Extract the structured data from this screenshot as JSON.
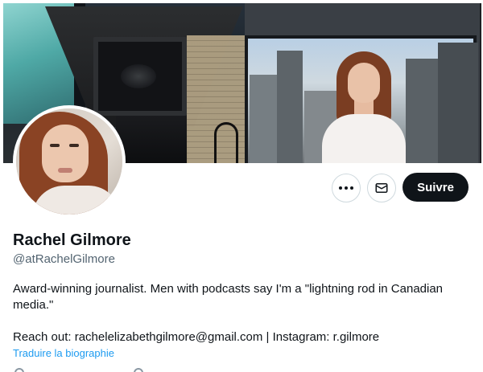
{
  "profile": {
    "display_name": "Rachel Gilmore",
    "handle": "@atRachelGilmore",
    "bio_line1": "Award-winning journalist. Men with podcasts say I'm a \"lightning rod in Canadian",
    "bio_line2": "media.\"",
    "bio_line3": "Reach out: rachelelizabethgilmore@gmail.com | Instagram: r.gilmore",
    "translate_label": "Traduire la biographie"
  },
  "actions": {
    "more_icon": "more-dots-icon",
    "message_icon": "mail-icon",
    "follow_label": "Suivre"
  },
  "colors": {
    "primary_text": "#0f1419",
    "secondary_text": "#536471",
    "link": "#1d9bf0",
    "follow_bg": "#0f1419",
    "button_border": "#cfd9de"
  }
}
